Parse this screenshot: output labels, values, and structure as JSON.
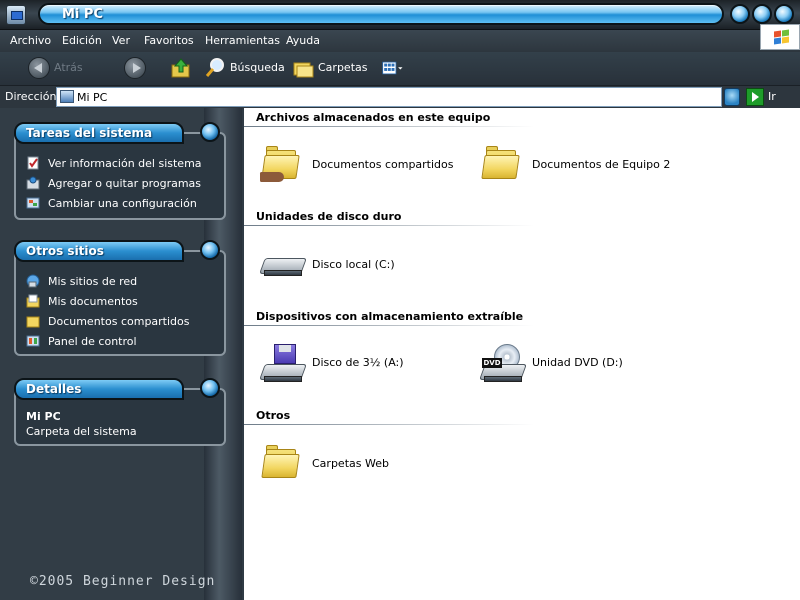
{
  "window": {
    "title": "Mi PC"
  },
  "menu": {
    "items": [
      "Archivo",
      "Edición",
      "Ver",
      "Favoritos",
      "Herramientas",
      "Ayuda"
    ]
  },
  "toolbar": {
    "back_label": "Atrás",
    "search_label": "Búsqueda",
    "folders_label": "Carpetas"
  },
  "address": {
    "label": "Dirección",
    "value": "Mi PC",
    "go_label": "Ir"
  },
  "sidebar": {
    "system_tasks": {
      "title": "Tareas del sistema",
      "items": [
        {
          "label": "Ver información del sistema",
          "icon": "system-info-icon"
        },
        {
          "label": "Agregar o quitar programas",
          "icon": "add-remove-programs-icon"
        },
        {
          "label": "Cambiar una configuración",
          "icon": "control-panel-settings-icon"
        }
      ]
    },
    "other_places": {
      "title": "Otros sitios",
      "items": [
        {
          "label": "Mis sitios de red",
          "icon": "network-places-icon"
        },
        {
          "label": "Mis documentos",
          "icon": "my-documents-icon"
        },
        {
          "label": "Documentos compartidos",
          "icon": "shared-folder-icon"
        },
        {
          "label": "Panel de control",
          "icon": "control-panel-icon"
        }
      ]
    },
    "details": {
      "title": "Detalles",
      "name": "Mi PC",
      "description": "Carpeta del sistema"
    },
    "footer": "©2005 Beginner Design"
  },
  "content": {
    "sections": [
      {
        "title": "Archivos almacenados en este equipo",
        "items": [
          {
            "label": "Documentos compartidos",
            "icon": "shared-folder-icon"
          },
          {
            "label": "Documentos de Equipo 2",
            "icon": "folder-icon"
          }
        ]
      },
      {
        "title": "Unidades de disco duro",
        "items": [
          {
            "label": "Disco local (C:)",
            "icon": "hard-drive-icon"
          }
        ]
      },
      {
        "title": "Dispositivos con almacenamiento extraíble",
        "items": [
          {
            "label": "Disco de 3½ (A:)",
            "icon": "floppy-drive-icon"
          },
          {
            "label": "Unidad DVD (D:)",
            "icon": "dvd-drive-icon"
          }
        ]
      },
      {
        "title": "Otros",
        "items": [
          {
            "label": "Carpetas Web",
            "icon": "folder-icon"
          }
        ]
      }
    ]
  },
  "colors": {
    "title_blue": "#2b8fd0",
    "panel_dark": "#2a3640",
    "content_bg": "#ffffff"
  }
}
